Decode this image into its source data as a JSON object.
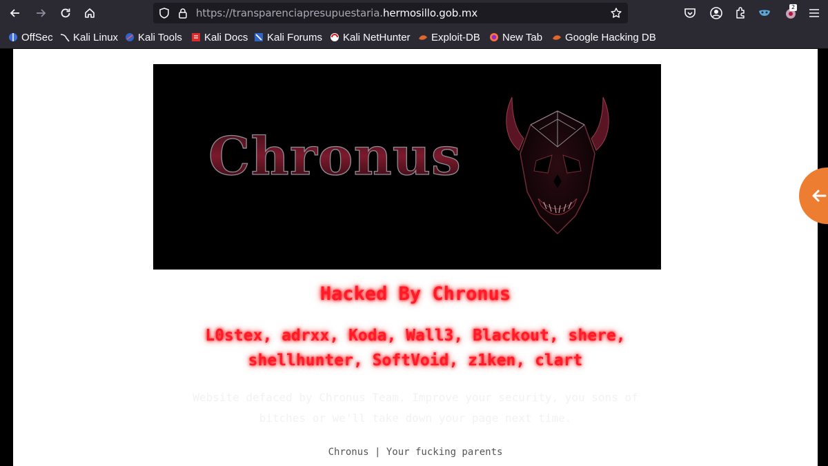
{
  "browser": {
    "url_prefix": "https://transparenciapresupuestaria.",
    "url_domain": "hermosillo.gob.mx",
    "extension_badge": "2"
  },
  "bookmarks": [
    {
      "label": "OffSec",
      "icon": "offsec-icon"
    },
    {
      "label": "Kali Linux",
      "icon": "kali-dragon-icon"
    },
    {
      "label": "Kali Tools",
      "icon": "kali-tools-icon"
    },
    {
      "label": "Kali Docs",
      "icon": "kali-docs-icon"
    },
    {
      "label": "Kali Forums",
      "icon": "kali-forums-icon"
    },
    {
      "label": "Kali NetHunter",
      "icon": "nethunter-icon"
    },
    {
      "label": "Exploit-DB",
      "icon": "exploit-db-icon"
    },
    {
      "label": "New Tab",
      "icon": "firefox-icon"
    },
    {
      "label": "Google Hacking DB",
      "icon": "ghdb-icon"
    }
  ],
  "page": {
    "banner_text": "Chronus",
    "headline": "Hacked By Chronus",
    "members_line1": "L0stex, adrxx, Koda, Wall3, Blackout, shere,",
    "members_line2": "shellhunter, SoftVoid, z1ken, clart",
    "faded_line1": "Website defaced by Chronus Team. Improve your security, you sons of",
    "faded_line2": "bitches or we'll take down your page next time.",
    "footer": "Chronus | Your fucking parents"
  },
  "colors": {
    "headline": "#ff1a2a",
    "side_tab": "#ed7d31",
    "toolbar": "#2b2a33"
  }
}
